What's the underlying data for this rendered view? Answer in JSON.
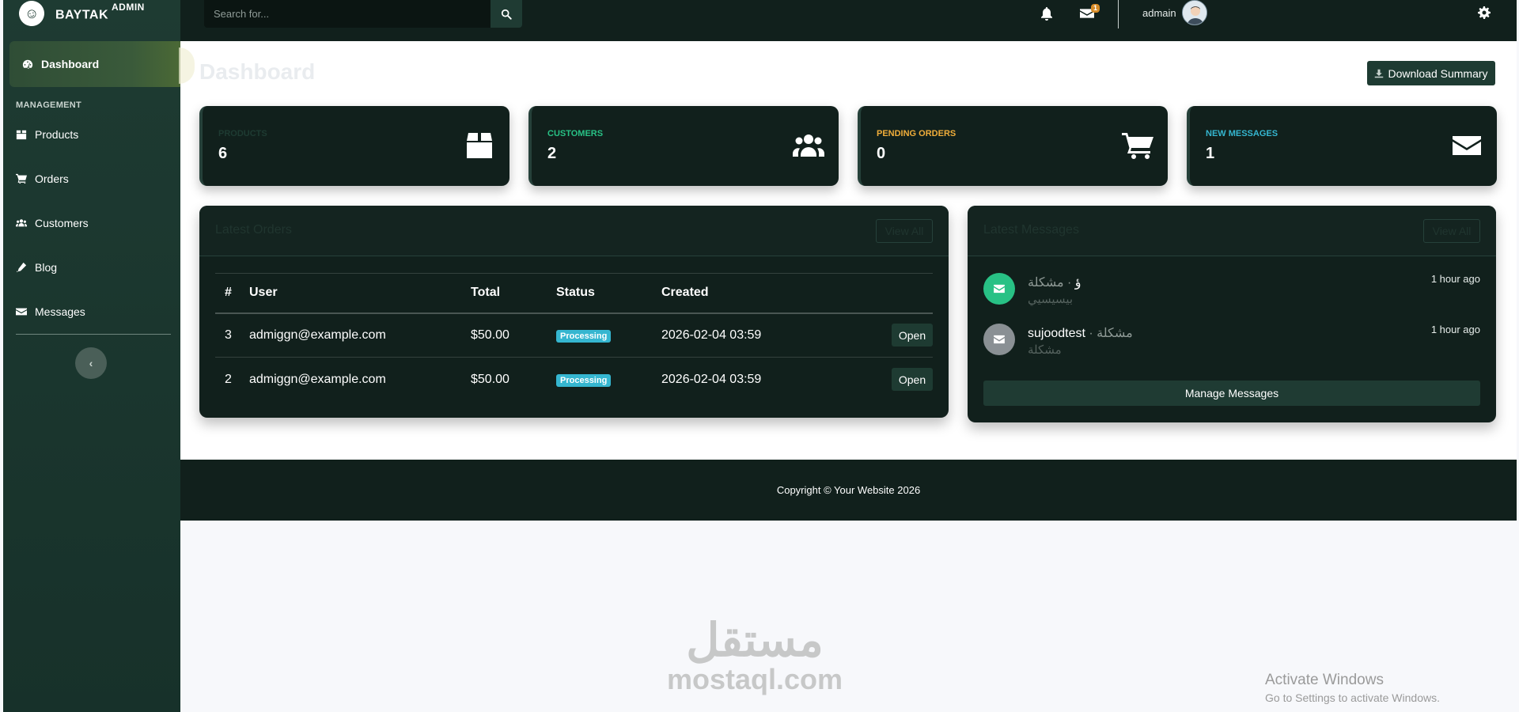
{
  "brand": {
    "name": "BAYTAK",
    "suffix": "ADMIN"
  },
  "sidebar": {
    "active": {
      "label": "Dashboard",
      "icon": "tachometer-icon"
    },
    "heading": "MANAGEMENT",
    "items": [
      {
        "label": "Products",
        "icon": "box-icon"
      },
      {
        "label": "Orders",
        "icon": "cart-icon"
      },
      {
        "label": "Customers",
        "icon": "users-icon"
      },
      {
        "label": "Blog",
        "icon": "pen-icon"
      },
      {
        "label": "Messages",
        "icon": "envelope-icon"
      }
    ],
    "collapse_glyph": "‹"
  },
  "topbar": {
    "search_placeholder": "Search for...",
    "mail_badge": "1",
    "user_name": "admain"
  },
  "main": {
    "title": "Dashboard",
    "download_label": "Download Summary",
    "stats": [
      {
        "label": "PRODUCTS",
        "value": "6",
        "color": "#1e3b32",
        "icon": "box-icon"
      },
      {
        "label": "CUSTOMERS",
        "value": "2",
        "color": "#28c185",
        "icon": "users-icon"
      },
      {
        "label": "PENDING ORDERS",
        "value": "0",
        "color": "#f0ad3a",
        "icon": "cart-icon"
      },
      {
        "label": "NEW MESSAGES",
        "value": "1",
        "color": "#35b6d0",
        "icon": "envelope-icon"
      }
    ],
    "orders": {
      "title": "Latest Orders",
      "view_all": "View All",
      "columns": [
        "#",
        "User",
        "Total",
        "Status",
        "Created"
      ],
      "rows": [
        {
          "id": "3",
          "user": "admiggn@example.com",
          "total": "$50.00",
          "status": "Processing",
          "created": "2026-02-04 03:59",
          "action": "Open"
        },
        {
          "id": "2",
          "user": "admiggn@example.com",
          "total": "$50.00",
          "status": "Processing",
          "created": "2026-02-04 03:59",
          "action": "Open"
        }
      ]
    },
    "messages": {
      "title": "Latest Messages",
      "view_all": "View All",
      "items": [
        {
          "sender": "ؤ",
          "subject": "مشكلة",
          "preview": "بيسيسيي",
          "time": "1 hour ago",
          "color": "#28c185"
        },
        {
          "sender": "sujoodtest",
          "subject": "مشكلة",
          "preview": "مشكلة",
          "time": "1 hour ago",
          "color": "#8a9094"
        }
      ],
      "manage_label": "Manage Messages"
    }
  },
  "footer": {
    "copyright": "Copyright © Your Website 2026"
  },
  "watermark": {
    "arabic": "مستقل",
    "latin": "mostaql.com"
  },
  "os_notice": {
    "title": "Activate Windows",
    "subtitle": "Go to Settings to activate Windows."
  }
}
